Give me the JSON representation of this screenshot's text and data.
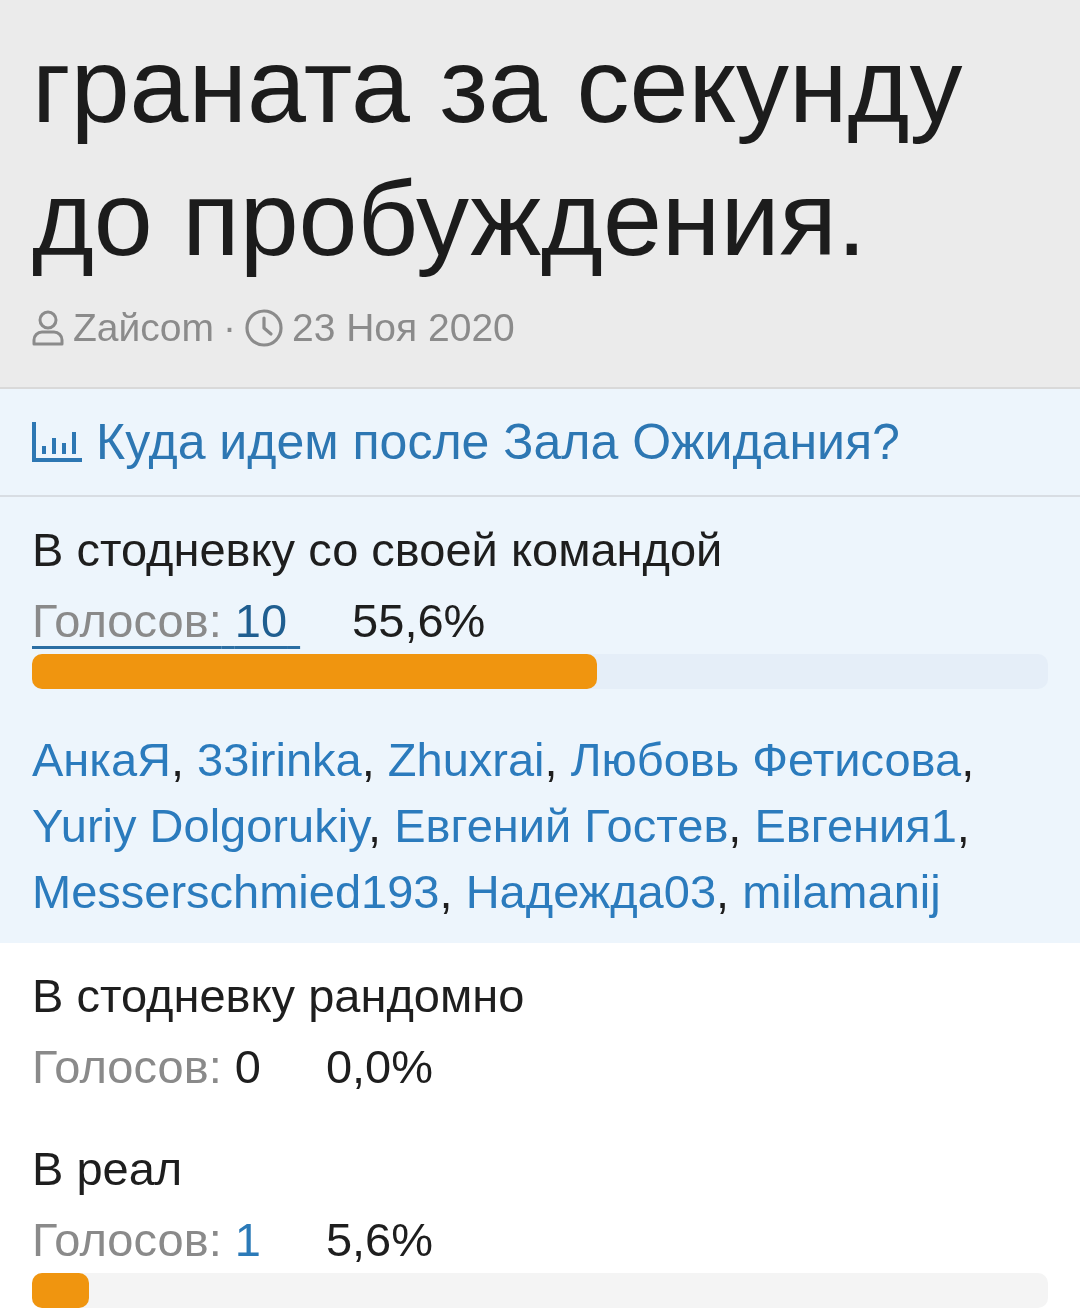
{
  "article": {
    "title": "граната за секунду до пробуждения.",
    "author": "Zaйcom",
    "separator": "·",
    "date": "23 Ноя 2020"
  },
  "poll": {
    "title": "Куда идем после Зала Ожидания?",
    "options": [
      {
        "label": "В стодневку со своей командой",
        "votes_label": "Голосов:",
        "votes": "10",
        "votes_link": true,
        "percent": "55,6%",
        "level": 0.556,
        "expanded": true,
        "voters": [
          {
            "name": "АнкаЯ",
            "suffix": ","
          },
          {
            "name": "33irinka",
            "suffix": ","
          },
          {
            "name": "Zhuxrai",
            "suffix": ","
          },
          {
            "name": "Любовь Фетисова",
            "suffix": ","
          },
          {
            "name": "Yuriy Dolgorukiy",
            "suffix": ","
          },
          {
            "name": "Евгений Гостев",
            "suffix": ","
          },
          {
            "name": "Евгения1",
            "suffix": ","
          },
          {
            "name": "Messerschmied193",
            "suffix": ","
          },
          {
            "name": "Надежда03",
            "suffix": ","
          },
          {
            "name": "milamanij"
          }
        ]
      },
      {
        "label": "В стодневку рандомно",
        "votes_label": "Голосов:",
        "votes": "0",
        "votes_link": false,
        "percent": "0,0%",
        "expanded": false
      },
      {
        "label": "В реал",
        "votes_label": "Голосов:",
        "votes": "1",
        "votes_link": true,
        "percent": "5,6%",
        "level": 0.056,
        "expanded": false
      }
    ]
  }
}
